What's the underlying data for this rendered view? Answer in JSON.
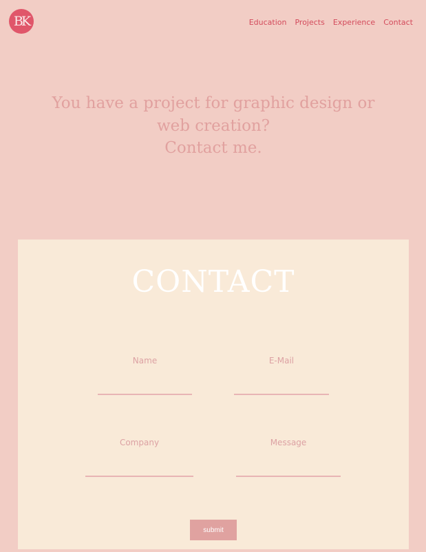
{
  "logo": {
    "text": "BK"
  },
  "nav": {
    "items": [
      "Education",
      "Projects",
      "Experience",
      "Contact"
    ]
  },
  "hero": {
    "line1": "You have a project for graphic design or",
    "line2": "web creation?",
    "line3": "Contact me."
  },
  "contact": {
    "title": "CONTACT",
    "fields": {
      "name": {
        "label": "Name",
        "value": ""
      },
      "email": {
        "label": "E-Mail",
        "value": ""
      },
      "company": {
        "label": "Company",
        "value": ""
      },
      "message": {
        "label": "Message",
        "value": ""
      }
    },
    "submit_label": "submit"
  },
  "colors": {
    "page_background": "#f2cdc5",
    "card_background": "#f9ead8",
    "accent": "#e0566a",
    "nav_text": "#d34a5b",
    "hero_text": "#e1a19f",
    "field_label": "#dca1a3",
    "field_underline": "#e8b4b4",
    "submit_background": "#e0a2a0"
  }
}
